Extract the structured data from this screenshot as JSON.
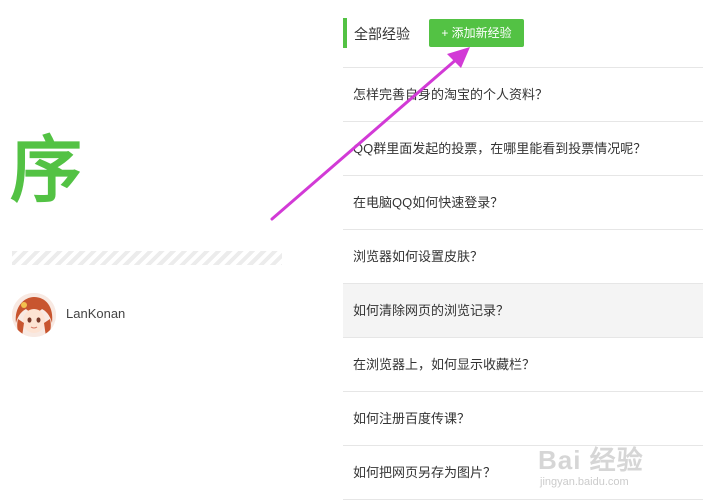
{
  "profile": {
    "big_char": "序",
    "username": "LanKonan"
  },
  "list_header": {
    "title": "全部经验",
    "add_button": "+ 添加新经验"
  },
  "items": [
    {
      "label": "怎样完善自身的淘宝的个人资料？"
    },
    {
      "label": "QQ群里面发起的投票，在哪里能看到投票情况呢？"
    },
    {
      "label": "在电脑QQ如何快速登录？"
    },
    {
      "label": "浏览器如何设置皮肤？"
    },
    {
      "label": "如何清除网页的浏览记录？"
    },
    {
      "label": "在浏览器上，如何显示收藏栏？"
    },
    {
      "label": "如何注册百度传课？"
    },
    {
      "label": "如何把网页另存为图片？"
    }
  ],
  "watermark": {
    "main": "Bai 经验",
    "sub": "jingyan.baidu.com"
  },
  "colors": {
    "accent": "#53c244",
    "arrow": "#d23ad6"
  }
}
